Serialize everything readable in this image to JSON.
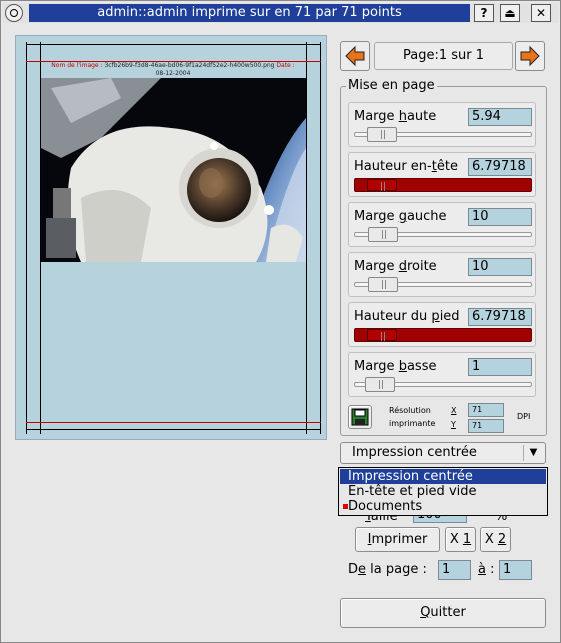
{
  "window": {
    "title": "admin::admin imprime sur  en 71 par 71 points",
    "menu_icon": "window-menu-icon",
    "help_label": "?",
    "shade_label": "⏏",
    "close_label": "✕"
  },
  "preview": {
    "header_label": "Nom de l'image :",
    "header_filename": "3cfb26b9-f3d8-46ae-bd06-9f1a24df52e2-h400w500.png",
    "header_date_label": "Date :",
    "header_date": "08-12-2004",
    "image_alt": "astronaut-photo"
  },
  "nav": {
    "page_label": "Page:1 sur 1"
  },
  "layout": {
    "group_title": "Mise en page",
    "rows": [
      {
        "label_pre": "Marge ",
        "label_u": "h",
        "label_post": "aute",
        "value": "5.94",
        "fill": 0.08,
        "red": false
      },
      {
        "label_pre": "Hauteur en-",
        "label_u": "t",
        "label_post": "ête",
        "value": "6.79718",
        "fill": 0.08,
        "red": true
      },
      {
        "label_pre": "Marge ",
        "label_u": "g",
        "label_post": "auche",
        "value": "10",
        "fill": 0.09,
        "red": false
      },
      {
        "label_pre": "Marge ",
        "label_u": "d",
        "label_post": "roite",
        "value": "10",
        "fill": 0.09,
        "red": false
      },
      {
        "label_pre": "Hauteur du ",
        "label_u": "p",
        "label_post": "ied",
        "value": "6.79718",
        "fill": 0.08,
        "red": true
      },
      {
        "label_pre": "Marge ",
        "label_u": "b",
        "label_post": "asse",
        "value": "1",
        "fill": 0.07,
        "red": false
      }
    ],
    "resolution_label_1": "Résolution",
    "resolution_label_2": "imprimante",
    "x_label": "X",
    "y_label": "Y",
    "x_value": "71",
    "y_value": "71",
    "dpi_label": "DPI"
  },
  "print_mode": {
    "selected": "Impression centrée",
    "options": [
      "Impression centrée",
      "En-tête et pied vide",
      "Documents"
    ]
  },
  "size": {
    "label_pre": "",
    "label_u": "T",
    "label_post": "aille",
    "value": "100",
    "unit": "%"
  },
  "buttons": {
    "print_u": "I",
    "print_rest": "mprimer",
    "x1_pre": "X ",
    "x1_u": "1",
    "x2_pre": "X ",
    "x2_u": "2",
    "quit_u": "Q",
    "quit_rest": "uitter"
  },
  "range": {
    "from_pre": "D",
    "from_u": "e",
    "from_post": " la page :",
    "from_value": "1",
    "to_u": "à",
    "to_post": " :",
    "to_value": "1"
  },
  "colors": {
    "accent": "#1f3f9a",
    "preview_bg": "#b6d2dc",
    "field_bg": "#b5d3de",
    "red_slider": "#a00000",
    "arrow": "#e8731a"
  }
}
